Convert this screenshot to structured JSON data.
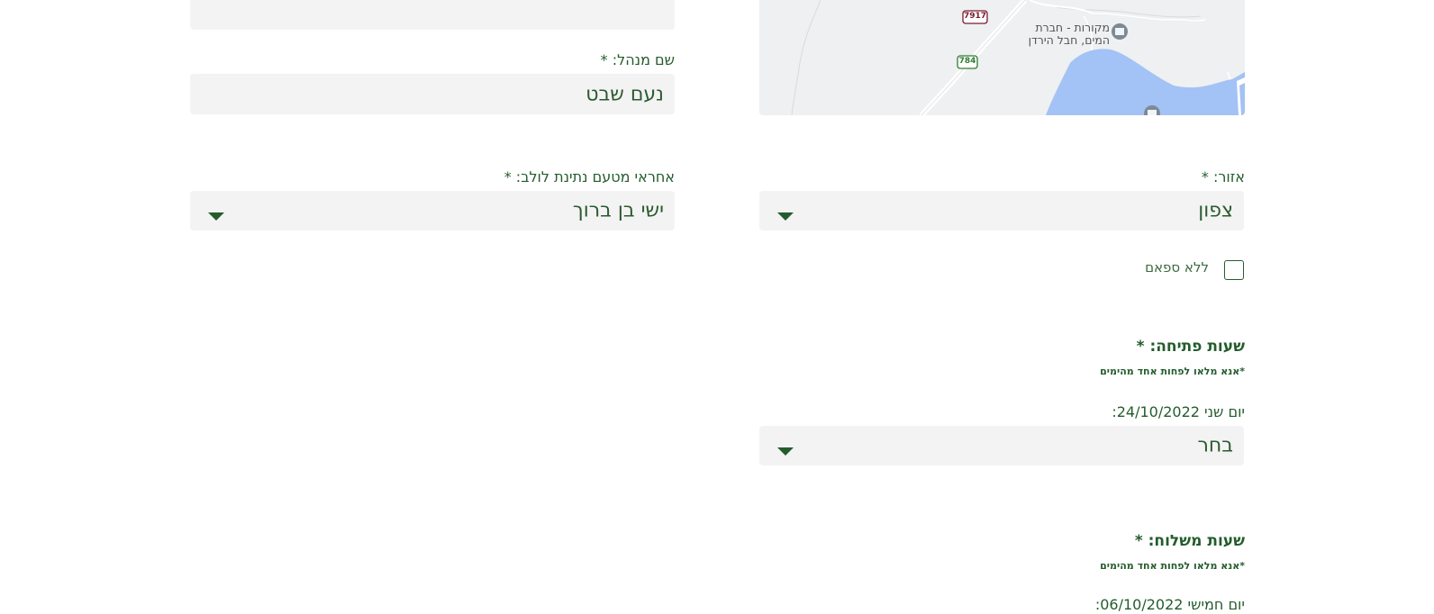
{
  "map": {
    "place_label_line1": "מקורות - חברת",
    "place_label_line2": "המים, חבל הירדן",
    "road_shield_1": "7917",
    "road_shield_2": "784"
  },
  "manager": {
    "label": "שם מנהל: *",
    "value": "נעם שבט"
  },
  "region": {
    "label": "אזור: *",
    "value": "צפון"
  },
  "responsible": {
    "label": "אחראי מטעם נתינת לולב: *",
    "value": "ישי בן ברוך"
  },
  "no_supplier": {
    "label": "ללא ספאם"
  },
  "opening_hours": {
    "title": "שעות פתיחה: *",
    "hint": "*אנא מלאו לפחות אחד מהימים",
    "day_label": "יום שני 24/10/2022:",
    "select_value": "בחר"
  },
  "delivery_hours": {
    "title": "שעות משלוח: *",
    "hint": "*אנא מלאו לפחות אחד מהימים",
    "day_label": "יום חמישי 06/10/2022:"
  },
  "colors": {
    "accent": "#245c2c",
    "field_bg": "#f3f3f3",
    "water": "#a3c2f5"
  }
}
